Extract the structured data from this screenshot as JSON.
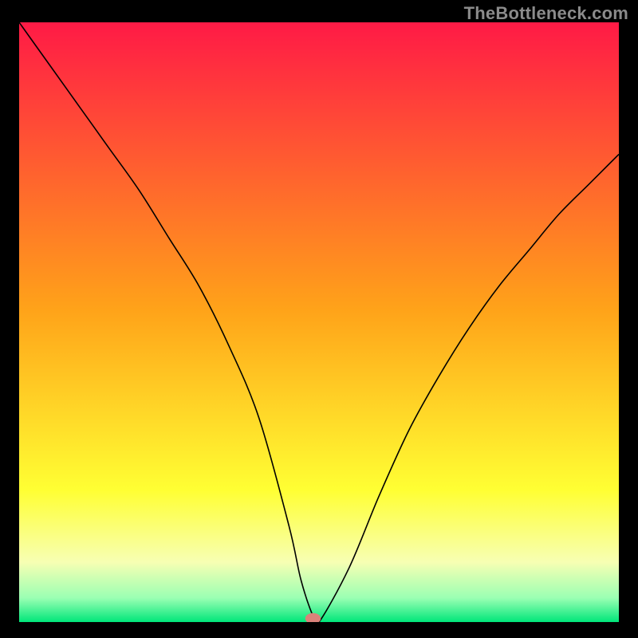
{
  "watermark": "TheBottleneck.com",
  "colors": {
    "red": "#ff1a46",
    "orange": "#ffa319",
    "yellow": "#ffff33",
    "pale": "#f7ffb3",
    "mint": "#9affb3",
    "green": "#00e67a",
    "curve": "#000000",
    "dot": "#d9827a"
  },
  "chart_data": {
    "type": "line",
    "title": "",
    "xlabel": "",
    "ylabel": "",
    "xlim": [
      0,
      100
    ],
    "ylim": [
      0,
      100
    ],
    "grid": false,
    "series": [
      {
        "name": "bottleneck-curve",
        "x": [
          0,
          5,
          10,
          15,
          20,
          25,
          30,
          35,
          40,
          45,
          47,
          49,
          50,
          55,
          60,
          65,
          70,
          75,
          80,
          85,
          90,
          95,
          100
        ],
        "y": [
          100,
          93,
          86,
          79,
          72,
          64,
          56,
          46,
          34,
          16,
          7,
          1,
          0,
          9,
          21,
          32,
          41,
          49,
          56,
          62,
          68,
          73,
          78
        ]
      }
    ],
    "marker": {
      "x": 49,
      "y": 0.6,
      "rx": 1.3,
      "ry": 0.9
    }
  }
}
